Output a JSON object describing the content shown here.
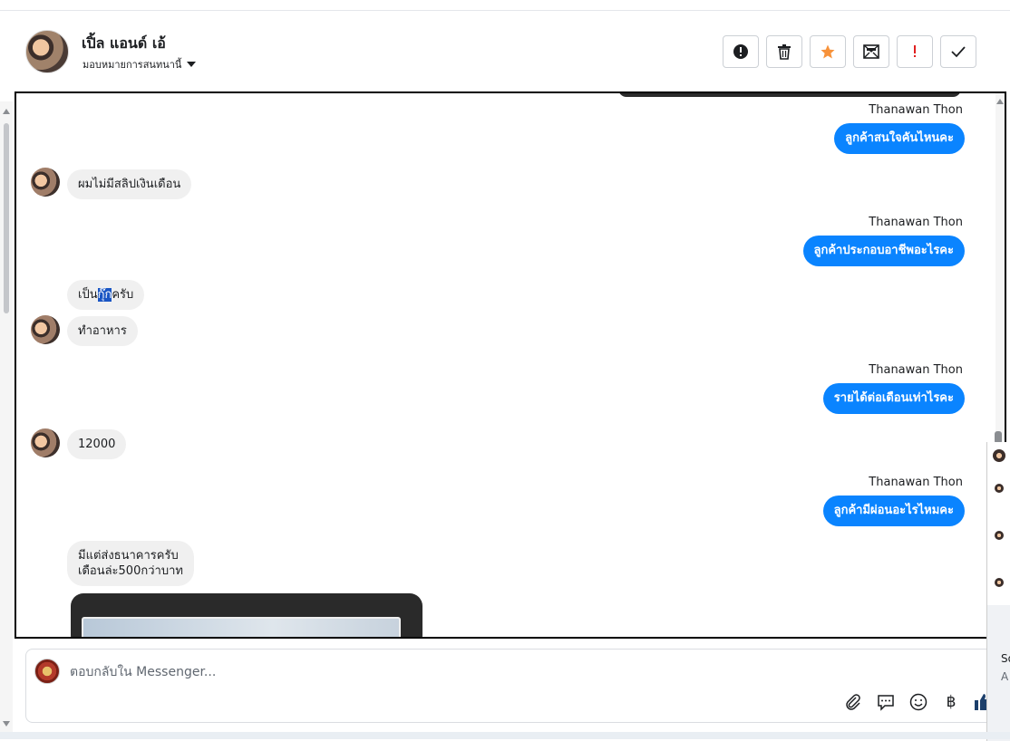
{
  "header": {
    "contact_name": "เปิ้ล แอนด์ เอ้",
    "assign_label": "มอบหมายการสนทนานี้",
    "actions": [
      {
        "name": "spam-button",
        "icon": "exclamation-circle-icon"
      },
      {
        "name": "delete-button",
        "icon": "trash-icon"
      },
      {
        "name": "star-button",
        "icon": "star-icon"
      },
      {
        "name": "mark-unread-button",
        "icon": "envelope-x-icon"
      },
      {
        "name": "important-button",
        "icon": "exclamation-icon"
      },
      {
        "name": "done-button",
        "icon": "check-icon"
      }
    ]
  },
  "messages": {
    "sender_1": "Thanawan Thon",
    "out_1": "ลูกค้าสนใจคันไหนคะ",
    "in_1": "ผมไม่มีสลิปเงินเดือน",
    "sender_2": "Thanawan Thon",
    "out_2": "ลูกค้าประกอบอาชีพอะไรคะ",
    "in_2_pre": "เป็น",
    "in_2_hl": "กุ๊ก",
    "in_2_post": "ครับ",
    "in_3": "ทำอาหาร",
    "sender_3": "Thanawan Thon",
    "out_3": "รายได้ต่อเดือนเท่าไรคะ",
    "in_4": "12000",
    "sender_4": "Thanawan Thon",
    "out_4": "ลูกค้ามีผ่อนอะไรไหมคะ",
    "in_5_line1": "มีแต่ส่งธนาคารครับ",
    "in_5_line2": "เดือนล่ะ500กว่าบาท"
  },
  "composer": {
    "placeholder": "ตอบกลับใน Messenger...",
    "tools": [
      "paperclip-icon",
      "saved-reply-icon",
      "emoji-icon",
      "baht-icon",
      "thumbs-up-icon"
    ],
    "baht_symbol": "฿"
  },
  "side": {
    "text_1": "So",
    "text_2": "A"
  },
  "colors": {
    "outgoing_bubble": "#0a84ff",
    "incoming_bubble": "#f0f0f0",
    "star": "#f7923a",
    "important": "#e02020"
  }
}
